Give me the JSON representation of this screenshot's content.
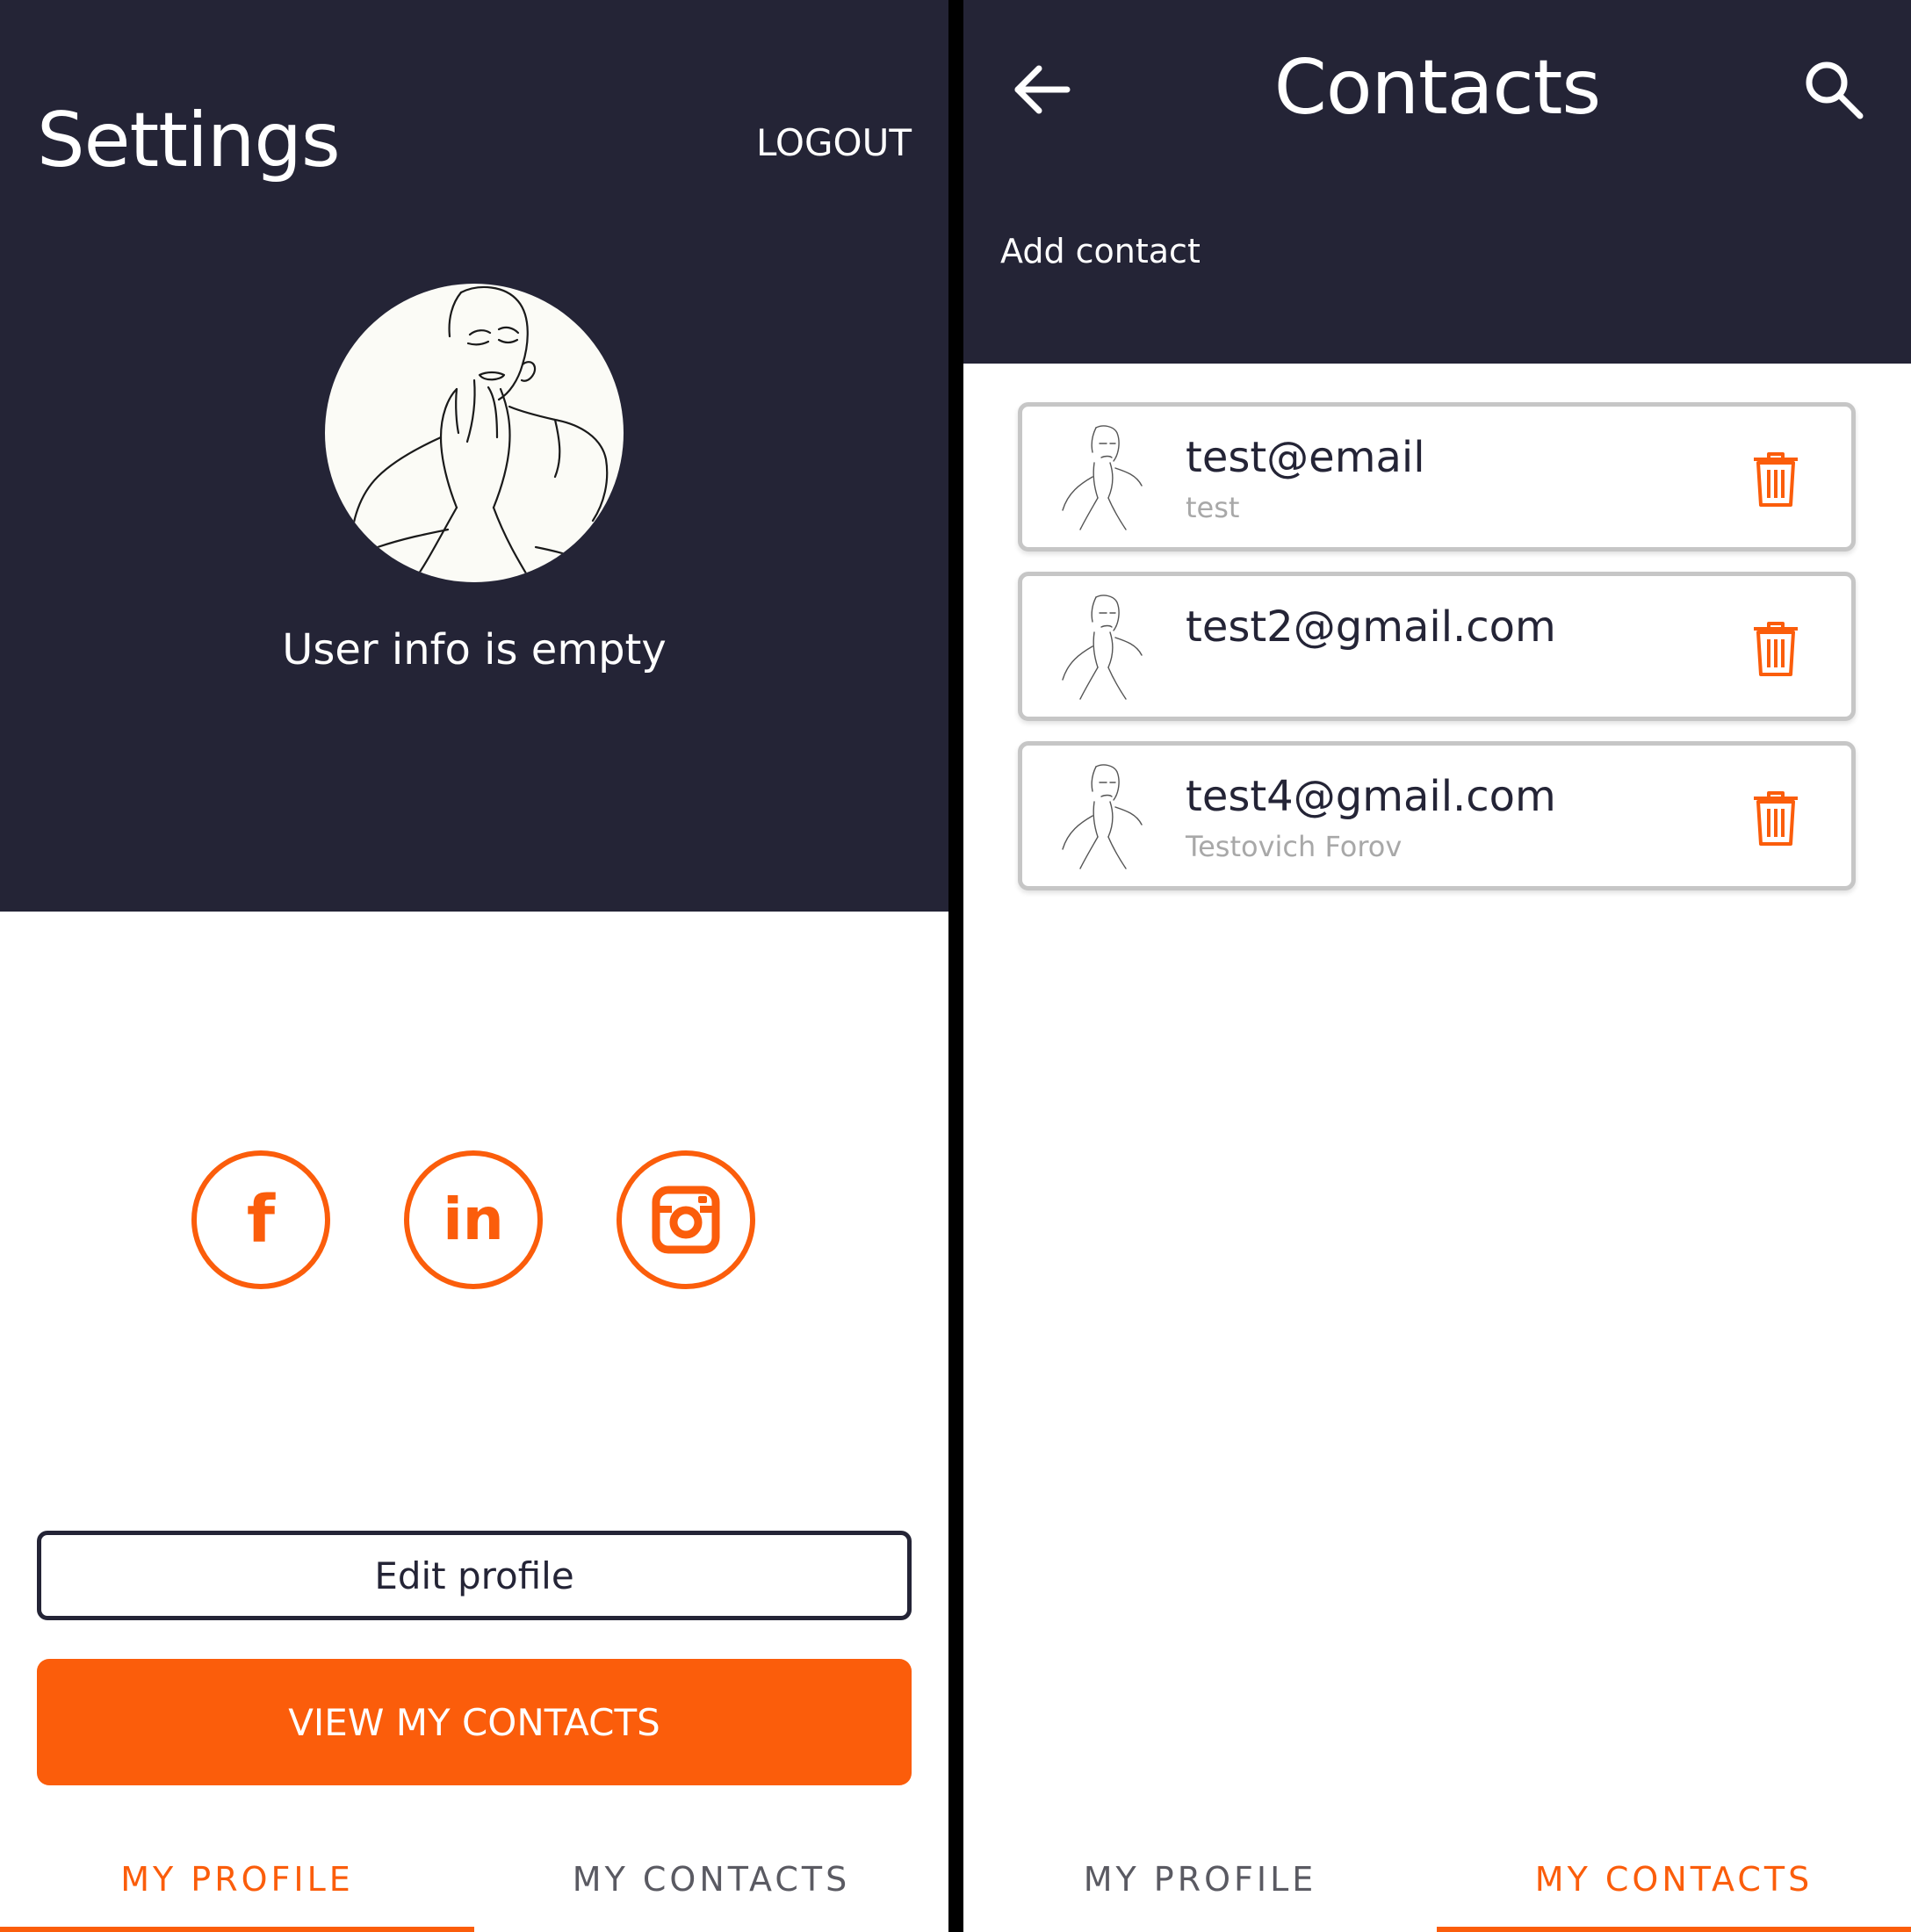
{
  "colors": {
    "header": "#242436",
    "accent": "#fb5d0b",
    "card_border": "#c6c6c6",
    "muted_text": "#a8a8a8"
  },
  "settings": {
    "title": "Settings",
    "logout_label": "LOGOUT",
    "avatar_icon": "meme-face-avatar",
    "user_info": "User info is empty",
    "social": [
      {
        "name": "facebook",
        "glyph": "f"
      },
      {
        "name": "linkedin",
        "glyph": "in"
      },
      {
        "name": "instagram",
        "glyph": "instagram-icon"
      }
    ],
    "edit_profile_label": "Edit profile",
    "view_contacts_label": "VIEW MY CONTACTS",
    "tabs": [
      {
        "label": "MY PROFILE",
        "active": true
      },
      {
        "label": "MY CONTACTS",
        "active": false
      }
    ]
  },
  "contacts": {
    "title": "Contacts",
    "back_icon": "arrow-left-icon",
    "search_icon": "search-icon",
    "add_contact_label": "Add contact",
    "items": [
      {
        "email": "test@email",
        "name": "test"
      },
      {
        "email": "test2@gmail.com",
        "name": ""
      },
      {
        "email": "test4@gmail.com",
        "name": "Testovich Forov"
      }
    ],
    "tabs": [
      {
        "label": "MY PROFILE",
        "active": false
      },
      {
        "label": "MY CONTACTS",
        "active": true
      }
    ]
  }
}
